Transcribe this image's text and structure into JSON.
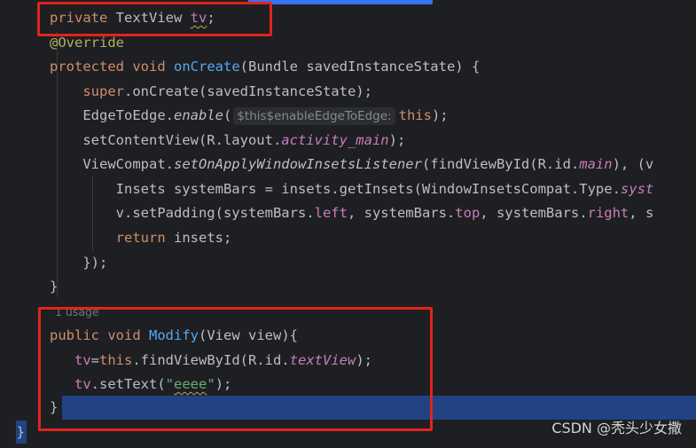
{
  "editor": {
    "lines": {
      "l1": {
        "kw": "private",
        "type": "TextView",
        "field": "tv",
        "end": ";"
      },
      "l2": {
        "ann": "@Override"
      },
      "l3": {
        "kw1": "protected",
        "kw2": "void",
        "fn": "onCreate",
        "rest": "(Bundle savedInstanceState) {"
      },
      "l4": {
        "kw": "super",
        "rest": ".onCreate(savedInstanceState);"
      },
      "l5": {
        "a": "EdgeToEdge.",
        "b": "enable",
        "c": "(",
        "hint": "$this$enableEdgeToEdge:",
        "d": "this",
        "e": ");"
      },
      "l6": {
        "a": "setContentView(R.layout.",
        "b": "activity_main",
        "c": ");"
      },
      "l7": {
        "a": "ViewCompat.",
        "b": "setOnApplyWindowInsetsListener",
        "c": "(findViewById(R.id.",
        "d": "main",
        "e": "), (v"
      },
      "l8": {
        "a": "Insets systemBars = insets.getInsets(WindowInsetsCompat.Type.",
        "b": "syst"
      },
      "l9": {
        "a": "v.setPadding(systemBars.",
        "b": "left",
        "c": ", systemBars.",
        "d": "top",
        "e": ", systemBars.",
        "f": "right",
        "g": ", s"
      },
      "l10": {
        "kw": "return",
        "rest": " insets;"
      },
      "l11": {
        "text": "});"
      },
      "l12": {
        "text": "}"
      },
      "usage": "1 usage",
      "l13": {
        "kw1": "public",
        "kw2": "void",
        "fn": "Modify",
        "rest": "(View view){"
      },
      "l14": {
        "field": "tv",
        "op": "=",
        "kw": "this",
        "a": ".findViewById(R.id.",
        "b": "textView",
        "c": ");"
      },
      "l15": {
        "field": "tv",
        "a": ".setText(",
        "str1": "\"",
        "str2": "eeee",
        "str3": "\"",
        "c": ");"
      },
      "l16": {
        "text": "}"
      },
      "l17": {
        "text": "}"
      }
    }
  },
  "watermark": "CSDN @秃头少女撒",
  "colors": {
    "background": "#1e1f22",
    "keyword": "#cf8e6d",
    "function": "#56a8f5",
    "annotation": "#b3ae60",
    "field": "#c77dbb",
    "string": "#6aab73",
    "highlight": "#214283",
    "annotation_box": "#e0241c"
  }
}
